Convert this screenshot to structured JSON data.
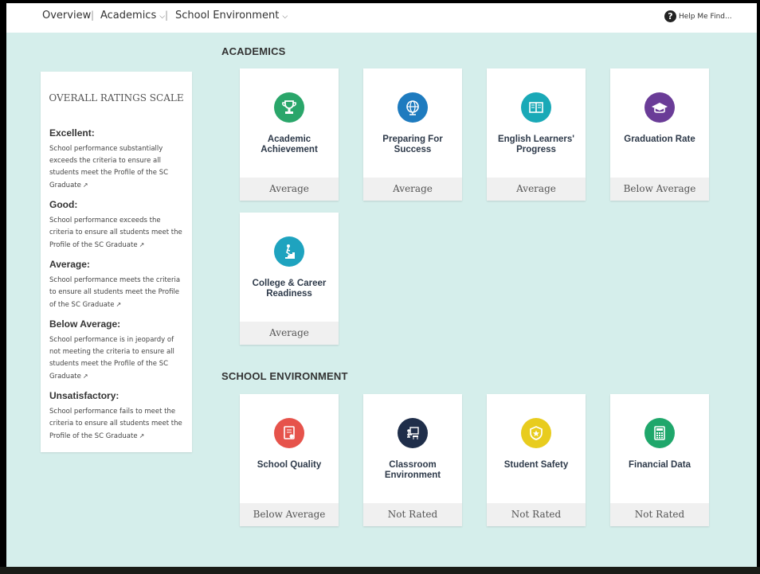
{
  "nav": {
    "overview": "Overview",
    "sep1": "|",
    "academics": "Academics",
    "sep2": "|",
    "school_environment": "School Environment",
    "help": "Help Me Find..."
  },
  "scale": {
    "title": "OVERALL RATINGS SCALE",
    "levels": [
      {
        "title": "Excellent:",
        "desc": "School performance substantially exceeds the criteria to ensure all students meet the Profile of the SC Graduate"
      },
      {
        "title": "Good:",
        "desc": "School performance exceeds the criteria to ensure all students meet the Profile of the SC Graduate"
      },
      {
        "title": "Average:",
        "desc": "School performance meets the criteria to ensure all students meet the Profile of the SC Graduate"
      },
      {
        "title": "Below Average:",
        "desc": "School performance is in jeopardy of not meeting the criteria to ensure all students meet the Profile of the SC Graduate"
      },
      {
        "title": "Unsatisfactory:",
        "desc": "School performance fails to meet the criteria to ensure all students meet the Profile of the SC Graduate"
      }
    ]
  },
  "academics": {
    "title": "ACADEMICS",
    "cards": [
      {
        "label": "Academic Achievement",
        "rating": "Average",
        "icon": "trophy-icon",
        "color": "#2aa66a"
      },
      {
        "label": "Preparing For Success",
        "rating": "Average",
        "icon": "globe-icon",
        "color": "#1e7bbf"
      },
      {
        "label": "English Learners' Progress",
        "rating": "Average",
        "icon": "book-icon",
        "color": "#1aa9b7"
      },
      {
        "label": "Graduation Rate",
        "rating": "Below Average",
        "icon": "graduation-cap-icon",
        "color": "#6a3c97"
      },
      {
        "label": "College & Career Readiness",
        "rating": "Average",
        "icon": "climbing-stairs-icon",
        "color": "#1ea3bf"
      }
    ]
  },
  "environment": {
    "title": "SCHOOL ENVIRONMENT",
    "cards": [
      {
        "label": "School Quality",
        "rating": "Below Average",
        "icon": "certificate-icon",
        "color": "#e6534b"
      },
      {
        "label": "Classroom Environment",
        "rating": "Not Rated",
        "icon": "classroom-icon",
        "color": "#1f2e4a"
      },
      {
        "label": "Student Safety",
        "rating": "Not Rated",
        "icon": "shield-icon",
        "color": "#e8cc1e"
      },
      {
        "label": "Financial Data",
        "rating": "Not Rated",
        "icon": "calculator-icon",
        "color": "#1fa76b"
      }
    ]
  }
}
